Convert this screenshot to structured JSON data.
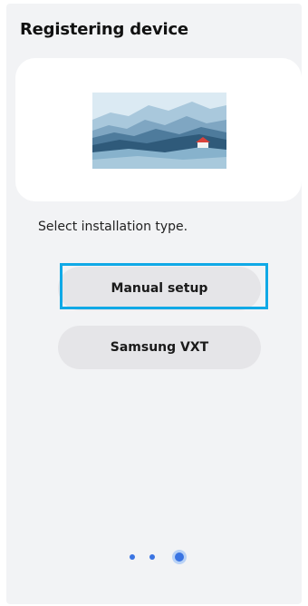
{
  "header": {
    "title": "Registering device"
  },
  "illustration": {
    "icon": "landscape-illustration",
    "colors": {
      "sky": "#cfe3ef",
      "mountain_far": "#9fc1d8",
      "mountain_mid": "#6f98b6",
      "mountain_dark": "#315d7d",
      "foreground": "#87b2cc",
      "house_roof": "#d9423b"
    }
  },
  "main": {
    "prompt": "Select installation type.",
    "options": [
      {
        "label": "Manual setup",
        "focused": true
      },
      {
        "label": "Samsung VXT",
        "focused": false
      }
    ]
  },
  "pager": {
    "total": 3,
    "current": 3
  },
  "colors": {
    "focus_ring": "#10a9e6",
    "accent": "#3a74e2",
    "background": "#f2f3f5",
    "button": "#e5e5e8"
  }
}
